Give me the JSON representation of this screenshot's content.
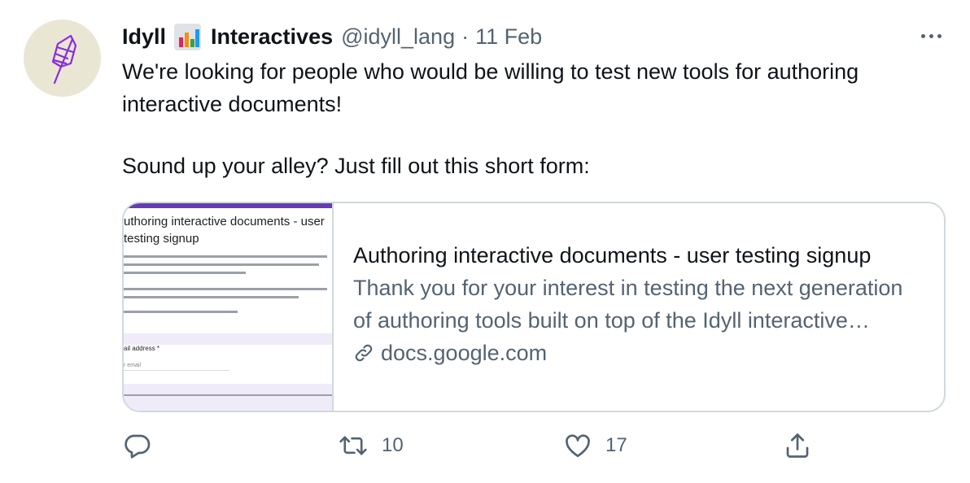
{
  "tweet": {
    "author": {
      "display_name_part1": "Idyll",
      "display_name_part2": "Interactives",
      "handle": "@idyll_lang",
      "separator": "·",
      "date": "11 Feb",
      "emoji_icon": "bar-chart-emoji"
    },
    "text": {
      "line1": "We're looking for people who would be willing to test new tools for authoring interactive documents!",
      "line2": "Sound up your alley? Just fill out this short form:"
    },
    "card": {
      "title": "Authoring interactive documents - user testing signup",
      "description": "Thank you for your interest in testing the next generation of authoring tools built on top of the Idyll interactive document model",
      "domain": "docs.google.com",
      "thumbnail": {
        "form_title": "uthoring interactive documents - user testing signup",
        "field_label": "ail address *",
        "field_placeholder": "r email"
      }
    },
    "actions": {
      "reply_count": "",
      "retweet_count": "10",
      "like_count": "17"
    }
  },
  "colors": {
    "text_primary": "#0f1419",
    "text_secondary": "#536471",
    "border": "#cfd9de",
    "avatar_bg": "#eae6d4",
    "logo_purple": "#8a2be2",
    "form_accent": "#673ab7"
  }
}
